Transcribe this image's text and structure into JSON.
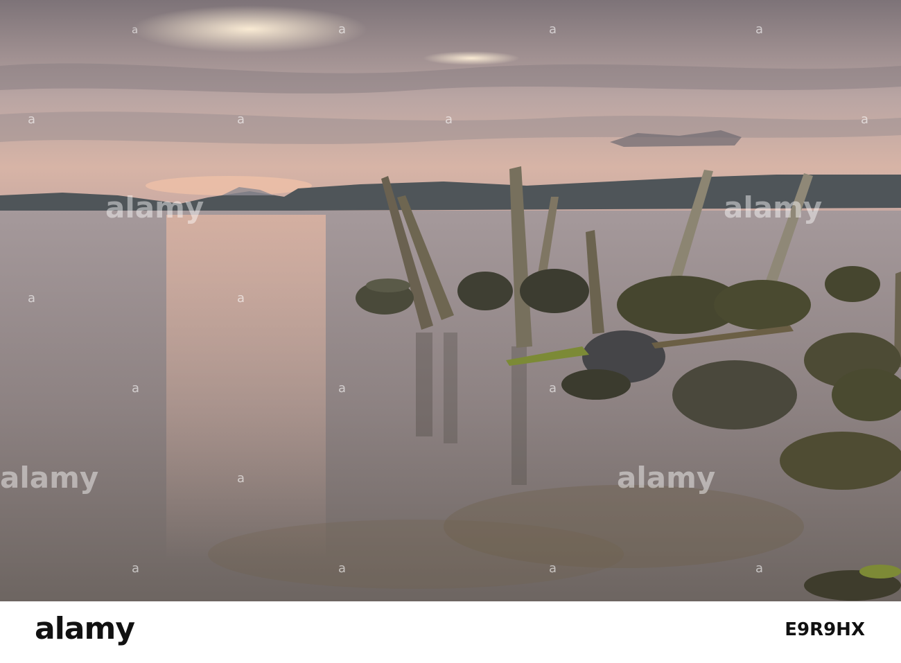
{
  "watermark": {
    "brand": "alamy",
    "stock_id": "E9R9HX",
    "mark": "a"
  },
  "colors": {
    "sky_top": "#8c8488",
    "sky_glow": "#e8c8b0",
    "water": "#9a8e8c",
    "mountains": "#4e5458",
    "rocks": "#3a3a32",
    "weed": "#6b6a32"
  }
}
